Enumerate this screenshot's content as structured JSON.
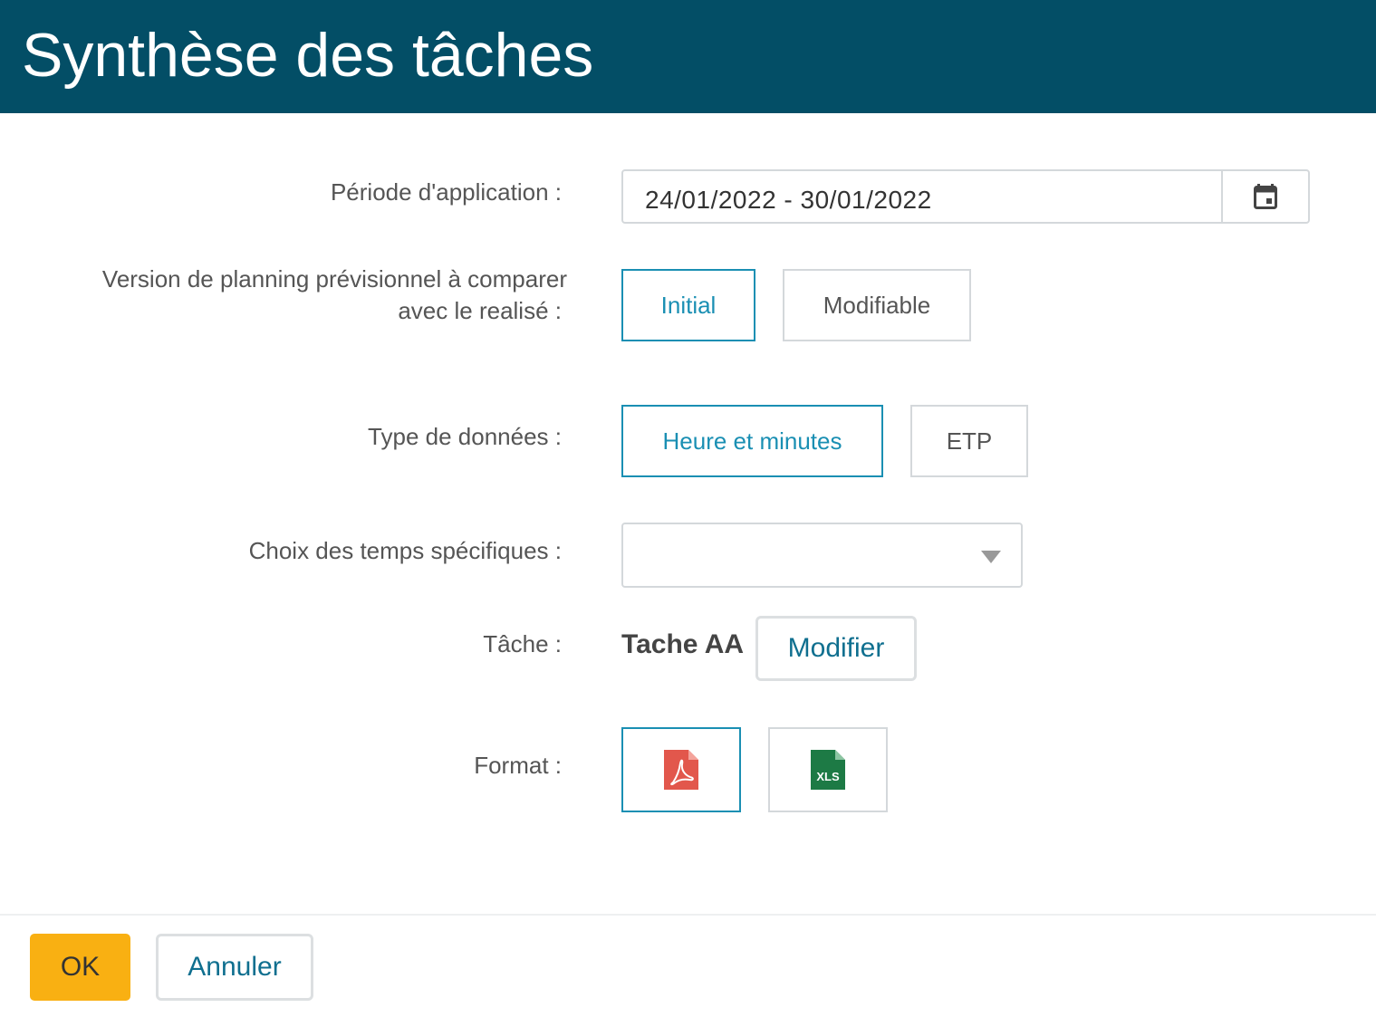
{
  "header": {
    "title": "Synthèse des tâches"
  },
  "form": {
    "period": {
      "label": "Période d'application :",
      "value": "24/01/2022 - 30/01/2022"
    },
    "version": {
      "label_line1": "Version de planning prévisionnel à comparer",
      "label_line2": "avec le realisé :",
      "options": [
        "Initial",
        "Modifiable"
      ],
      "selected": "Initial"
    },
    "data_type": {
      "label": "Type de données :",
      "options": [
        "Heure et minutes",
        "ETP"
      ],
      "selected": "Heure et minutes"
    },
    "specific_times": {
      "label": "Choix des temps spécifiques  :",
      "value": ""
    },
    "task": {
      "label": "Tâche :",
      "value": "Tache AA",
      "modify_label": "Modifier"
    },
    "format": {
      "label": "Format :",
      "options": [
        "pdf-file-icon",
        "xls-file-icon"
      ],
      "xls_badge": "XLS",
      "selected": "pdf",
      "colors": {
        "pdf": "#e2574c",
        "xls": "#1d7a45"
      }
    }
  },
  "footer": {
    "ok_label": "OK",
    "cancel_label": "Annuler"
  },
  "colors": {
    "header_bg": "#034e66",
    "accent": "#1a8fb3",
    "ok_bg": "#f9b012"
  }
}
